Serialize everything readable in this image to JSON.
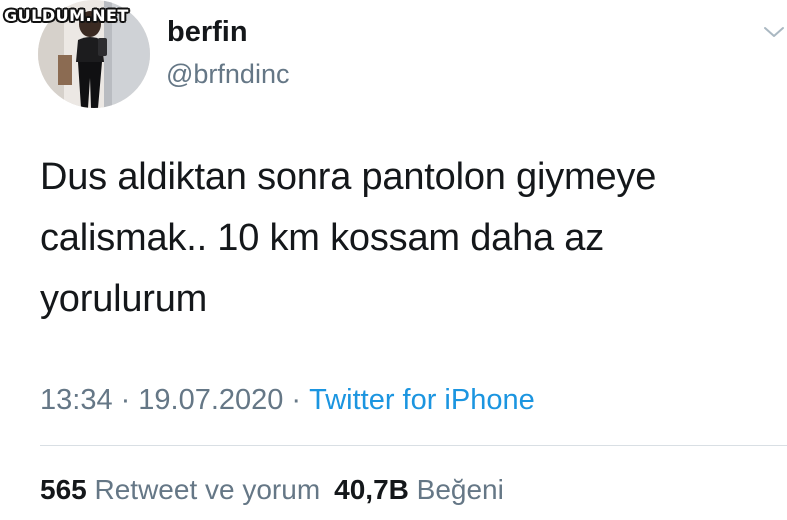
{
  "watermark": "GULDUM.NET",
  "user": {
    "display_name": "berfin",
    "handle": "@brfndinc",
    "avatar_icon": "profile-photo"
  },
  "menu_icon": "chevron-down-icon",
  "tweet": {
    "lines": [
      "Dus aldiktan sonra pantolon giymeye",
      "calismak.. 10 km kossam daha az",
      "yorulurum"
    ]
  },
  "meta": {
    "time": "13:34",
    "separator": "·",
    "date": "19.07.2020",
    "source": "Twitter for iPhone"
  },
  "stats": {
    "retweets_count": "565",
    "retweets_label": "Retweet ve yorum",
    "likes_count": "40,7B",
    "likes_label": "Beğeni"
  },
  "colors": {
    "text": "#14171a",
    "secondary": "#657786",
    "link": "#1b95e0",
    "divider": "#d9dfe4"
  }
}
